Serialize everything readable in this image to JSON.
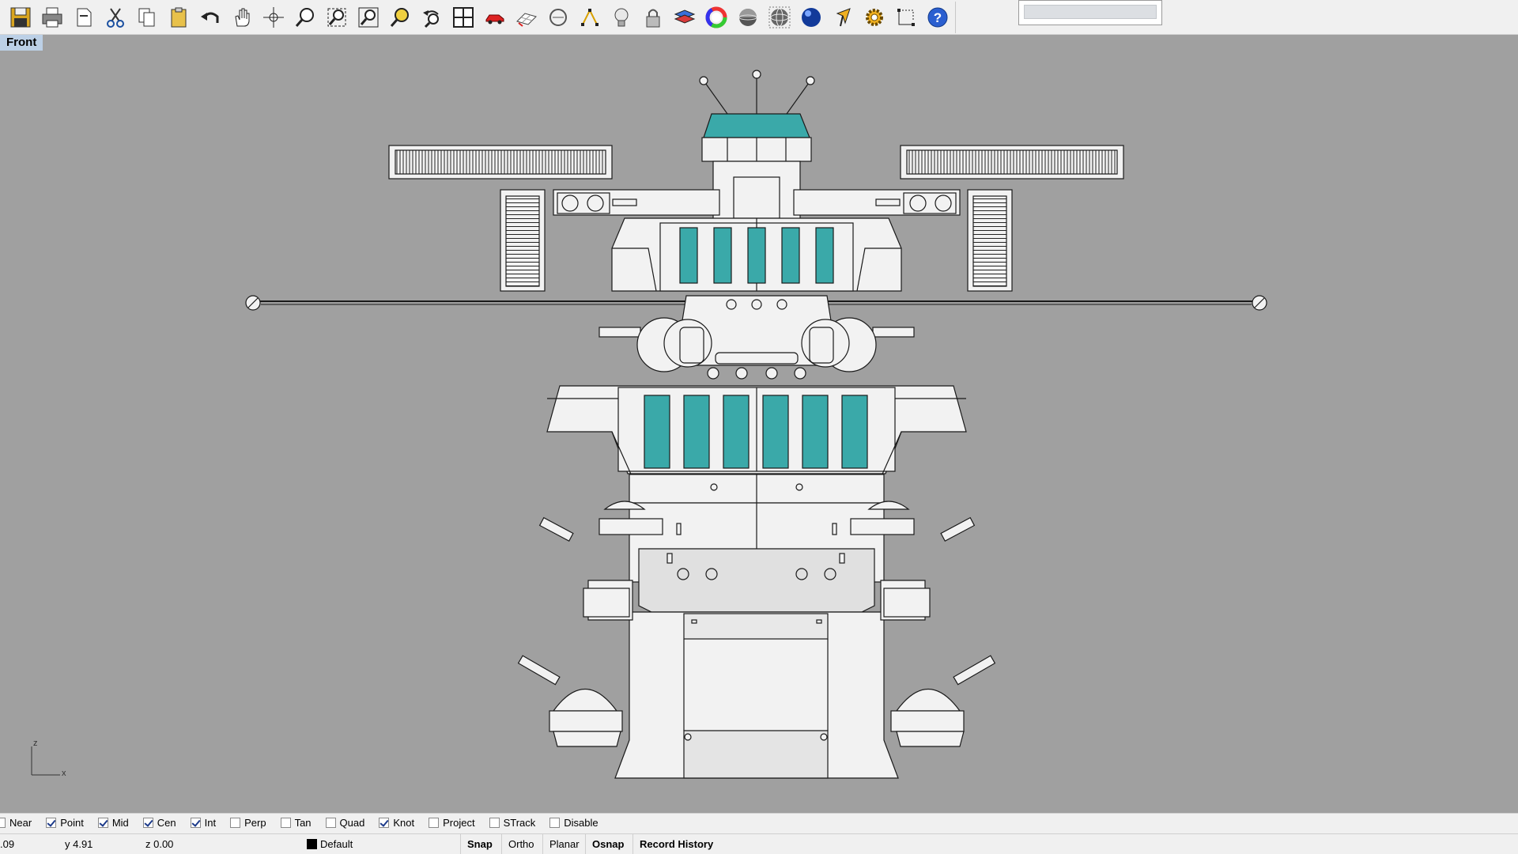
{
  "toolbar": {
    "icons": [
      "save-icon",
      "print-icon",
      "paste-new-icon",
      "cut-icon",
      "copy-icon",
      "paste-icon",
      "undo-icon",
      "pan-icon",
      "rotate-view-icon",
      "zoom-icon",
      "zoom-window-icon",
      "zoom-extents-icon",
      "zoom-selected-icon",
      "undo-view-icon",
      "four-viewports-icon",
      "car-object-icon",
      "grid-plane-icon",
      "cplane-icon",
      "point-edit-icon",
      "light-bulb-icon",
      "lock-icon",
      "layer-icon",
      "color-wheel-icon",
      "shaded-sphere-icon",
      "wire-sphere-icon",
      "render-sphere-icon",
      "select-arrow-icon",
      "settings-gear-icon",
      "dimension-icon",
      "help-icon"
    ]
  },
  "viewport": {
    "label": "Front",
    "background": "#a0a0a0",
    "axis_z": "z",
    "axis_x": "x"
  },
  "osnap": [
    {
      "label": "Near",
      "checked": false
    },
    {
      "label": "Point",
      "checked": true
    },
    {
      "label": "Mid",
      "checked": true
    },
    {
      "label": "Cen",
      "checked": true
    },
    {
      "label": "Int",
      "checked": true
    },
    {
      "label": "Perp",
      "checked": false
    },
    {
      "label": "Tan",
      "checked": false
    },
    {
      "label": "Quad",
      "checked": false
    },
    {
      "label": "Knot",
      "checked": true
    },
    {
      "label": "Project",
      "checked": false
    },
    {
      "label": "STrack",
      "checked": false
    },
    {
      "label": "Disable",
      "checked": false
    }
  ],
  "status": {
    "x": ".09",
    "y": "y 4.91",
    "z": "z 0.00",
    "layer": "Default",
    "snap": "Snap",
    "ortho": "Ortho",
    "planar": "Planar",
    "osnap": "Osnap",
    "record_history": "Record History"
  },
  "colors": {
    "teal": "#3aa9a9",
    "hull": "#f2f2f2",
    "viewport_bg": "#a0a0a0"
  }
}
